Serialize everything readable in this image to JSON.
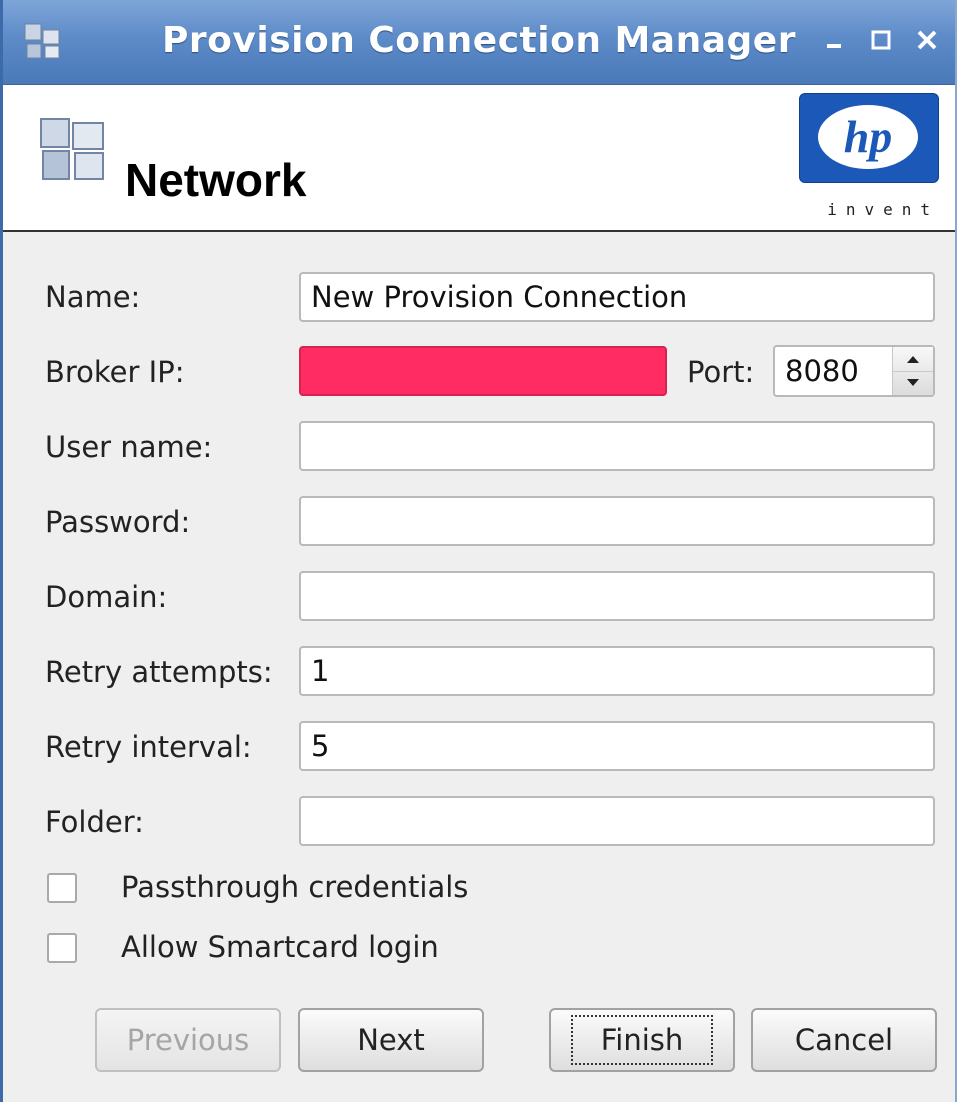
{
  "window": {
    "title": "Provision Connection Manager",
    "controls": [
      "minimize-icon",
      "maximize-icon",
      "close-icon"
    ]
  },
  "header": {
    "title": "Network",
    "logo_text": "invent",
    "logo_mark": "hp"
  },
  "form": {
    "name_label": "Name:",
    "name_value": "New Provision Connection",
    "broker_ip_label": "Broker IP:",
    "broker_ip_value": "",
    "port_label": "Port:",
    "port_value": "8080",
    "user_name_label": "User name:",
    "user_name_value": "",
    "password_label": "Password:",
    "password_value": "",
    "domain_label": "Domain:",
    "domain_value": "",
    "retry_attempts_label": "Retry attempts:",
    "retry_attempts_value": "1",
    "retry_interval_label": "Retry interval:",
    "retry_interval_value": "5",
    "folder_label": "Folder:",
    "folder_value": ""
  },
  "options": {
    "passthrough_label": "Passthrough credentials",
    "passthrough_checked": false,
    "smartcard_label": "Allow Smartcard login",
    "smartcard_checked": false
  },
  "buttons": {
    "previous": "Previous",
    "next": "Next",
    "finish": "Finish",
    "cancel": "Cancel"
  },
  "colors": {
    "titlebar": "#5d8bc8",
    "error_field": "#ff2c63",
    "hp_blue": "#1b58b7"
  }
}
